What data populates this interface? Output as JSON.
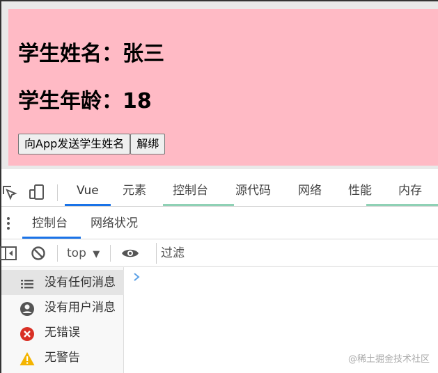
{
  "page": {
    "student_name_label": "学生姓名：张三",
    "student_age_label": "学生年龄：18",
    "send_button": "向App发送学生姓名",
    "unbind_button": "解绑",
    "card_color": "#ffbac5"
  },
  "devtools": {
    "tabs": [
      {
        "label": "Vue",
        "active": true
      },
      {
        "label": "元素"
      },
      {
        "label": "控制台"
      },
      {
        "label": "源代码"
      },
      {
        "label": "网络"
      },
      {
        "label": "性能"
      },
      {
        "label": "内存"
      }
    ],
    "sub_tabs": [
      {
        "label": "控制台",
        "active": true
      },
      {
        "label": "网络状况"
      }
    ],
    "context_select": "top",
    "filter_placeholder": "过滤",
    "sidebar": [
      {
        "label": "没有任何消息",
        "icon": "list-icon",
        "selected": true
      },
      {
        "label": "没有用户消息",
        "icon": "user-icon"
      },
      {
        "label": "无错误",
        "icon": "error-icon"
      },
      {
        "label": "无警告",
        "icon": "warning-icon"
      }
    ],
    "accent_color": "#1a73e8",
    "tab_highlight_color": "#8fd1b5"
  },
  "watermark": "@稀土掘金技术社区"
}
